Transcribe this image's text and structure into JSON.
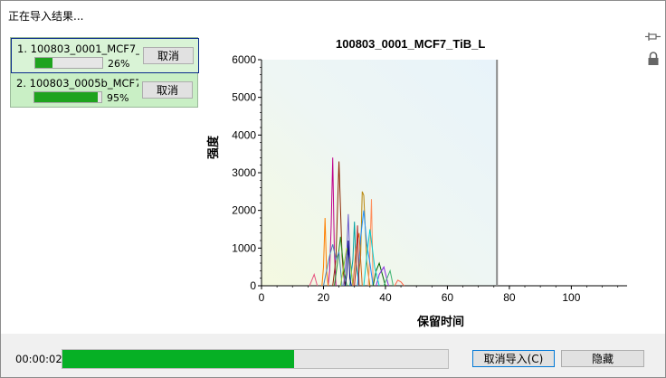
{
  "window": {
    "title": "正在导入结果..."
  },
  "jobs": [
    {
      "name": "1. 100803_0001_MCF7_...",
      "progress_pct": 26,
      "pct_label": "26%",
      "cancel_label": "取消",
      "selected": true
    },
    {
      "name": "2. 100803_0005b_MCF7...",
      "progress_pct": 95,
      "pct_label": "95%",
      "cancel_label": "取消",
      "selected": false
    }
  ],
  "icons": {
    "pin": "pin-icon",
    "lock": "lock-icon"
  },
  "chart_data": {
    "type": "line",
    "title": "100803_0001_MCF7_TiB_L",
    "xlabel": "保留时间",
    "ylabel": "强度",
    "xlim": [
      0,
      118
    ],
    "ylim": [
      0,
      6000
    ],
    "xticks": [
      0,
      20,
      40,
      60,
      80,
      100
    ],
    "yticks": [
      0,
      1000,
      2000,
      3000,
      4000,
      5000,
      6000
    ],
    "progress_line_x": 76,
    "series": [
      {
        "color": "#c0008a",
        "x": [
          21.5,
          22.0,
          22.5,
          23.0,
          23.5,
          24.0
        ],
        "y": [
          0,
          400,
          1600,
          3400,
          900,
          0
        ]
      },
      {
        "color": "#8b2500",
        "x": [
          23.0,
          24.0,
          25.0,
          26.0,
          26.5,
          27.0
        ],
        "y": [
          0,
          700,
          3300,
          800,
          300,
          0
        ]
      },
      {
        "color": "#b8860b",
        "x": [
          31.0,
          32.0,
          32.5,
          33.0,
          34.0,
          35.0
        ],
        "y": [
          0,
          800,
          2500,
          2400,
          600,
          0
        ]
      },
      {
        "color": "#ff8c5a",
        "x": [
          34.5,
          35.0,
          35.5,
          36.0
        ],
        "y": [
          0,
          900,
          2300,
          0
        ]
      },
      {
        "color": "#6a5acd",
        "x": [
          26.5,
          27.5,
          28.0,
          28.5,
          29.5
        ],
        "y": [
          0,
          900,
          1900,
          800,
          0
        ]
      },
      {
        "color": "#00a0a0",
        "x": [
          28.5,
          29.5,
          30.0,
          30.5,
          31.5
        ],
        "y": [
          0,
          700,
          1700,
          600,
          0
        ]
      },
      {
        "color": "#228b22",
        "x": [
          23.5,
          24.5,
          25.5,
          26.5,
          27.5
        ],
        "y": [
          0,
          600,
          1300,
          500,
          0
        ]
      },
      {
        "color": "#ff7f00",
        "x": [
          19.5,
          20.0,
          20.5,
          21.0,
          21.5
        ],
        "y": [
          0,
          500,
          1800,
          400,
          0
        ]
      },
      {
        "color": "#e75480",
        "x": [
          15.5,
          16.5,
          17.0,
          18.0
        ],
        "y": [
          0,
          200,
          300,
          0
        ]
      },
      {
        "color": "#1e90ff",
        "x": [
          31.0,
          32.0,
          33.0,
          34.0,
          35.0,
          36.0
        ],
        "y": [
          0,
          1300,
          2000,
          1100,
          600,
          0
        ]
      },
      {
        "color": "#006400",
        "x": [
          36.0,
          37.0,
          38.0,
          39.0,
          40.0
        ],
        "y": [
          0,
          400,
          600,
          300,
          0
        ]
      },
      {
        "color": "#8a2be2",
        "x": [
          37.0,
          38.0,
          39.5,
          41.0
        ],
        "y": [
          0,
          300,
          500,
          0
        ]
      },
      {
        "color": "#3cb371",
        "x": [
          39.5,
          40.5,
          41.5,
          42.5
        ],
        "y": [
          0,
          200,
          400,
          0
        ]
      },
      {
        "color": "#ff6347",
        "x": [
          43.0,
          44.0,
          45.0,
          46.0
        ],
        "y": [
          0,
          150,
          100,
          0
        ]
      },
      {
        "color": "#4682b4",
        "x": [
          20.0,
          21.0,
          22.0,
          23.0,
          24.0,
          25.0,
          26.0
        ],
        "y": [
          0,
          400,
          800,
          1100,
          700,
          900,
          0
        ]
      },
      {
        "color": "#9acd32",
        "x": [
          25.5,
          26.5,
          27.5,
          28.5,
          29.5
        ],
        "y": [
          0,
          500,
          1000,
          700,
          0
        ]
      },
      {
        "color": "#d2691e",
        "x": [
          29.5,
          30.5,
          31.5,
          32.5
        ],
        "y": [
          0,
          1000,
          1400,
          0
        ]
      },
      {
        "color": "#00ced1",
        "x": [
          33.0,
          34.0,
          35.0,
          36.5,
          38.0
        ],
        "y": [
          0,
          800,
          1500,
          500,
          0
        ]
      },
      {
        "color": "#000080",
        "x": [
          27.0,
          27.5,
          28.0,
          28.5,
          29.0
        ],
        "y": [
          0,
          300,
          1200,
          200,
          0
        ]
      },
      {
        "color": "#b22222",
        "x": [
          30.0,
          30.5,
          31.0,
          31.5
        ],
        "y": [
          0,
          500,
          1600,
          0
        ]
      }
    ]
  },
  "footer": {
    "elapsed": "00:00:02",
    "progress_pct": 60,
    "cancel_import_label": "取消导入(C)",
    "hide_label": "隐藏"
  }
}
